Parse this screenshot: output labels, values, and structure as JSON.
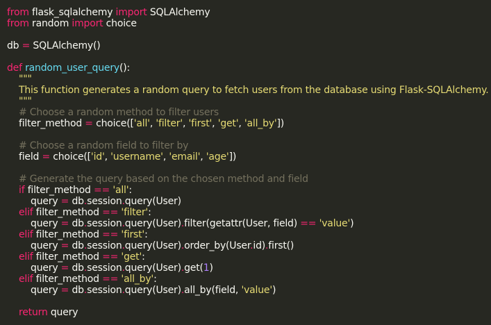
{
  "colors": {
    "background": "#272822",
    "text": "#f8f8f2",
    "keyword": "#f92672",
    "function": "#66d9ef",
    "string": "#e6db74",
    "comment": "#75715e",
    "number": "#ae81ff"
  },
  "lines": [
    [
      {
        "t": "kw",
        "v": "from"
      },
      {
        "t": "plain",
        "v": " flask_sqlalchemy "
      },
      {
        "t": "kw",
        "v": "import"
      },
      {
        "t": "plain",
        "v": " SQLAlchemy"
      }
    ],
    [
      {
        "t": "kw",
        "v": "from"
      },
      {
        "t": "plain",
        "v": " random "
      },
      {
        "t": "kw",
        "v": "import"
      },
      {
        "t": "plain",
        "v": " choice"
      }
    ],
    [],
    [
      {
        "t": "plain",
        "v": "db "
      },
      {
        "t": "op",
        "v": "="
      },
      {
        "t": "plain",
        "v": " SQLAlchemy()"
      }
    ],
    [],
    [
      {
        "t": "kw",
        "v": "def"
      },
      {
        "t": "plain",
        "v": " "
      },
      {
        "t": "fn",
        "v": "random_user_query"
      },
      {
        "t": "plain",
        "v": "():"
      }
    ],
    [
      {
        "t": "str",
        "v": "    \"\"\""
      }
    ],
    [
      {
        "t": "str",
        "v": "    This function generates a random query to fetch users from the database using Flask-SQLAlchemy."
      }
    ],
    [
      {
        "t": "str",
        "v": "    \"\"\""
      }
    ],
    [
      {
        "t": "cmt",
        "v": "    # Choose a random method to filter users"
      }
    ],
    [
      {
        "t": "plain",
        "v": "    filter_method "
      },
      {
        "t": "op",
        "v": "="
      },
      {
        "t": "plain",
        "v": " choice(["
      },
      {
        "t": "str",
        "v": "'all'"
      },
      {
        "t": "plain",
        "v": ", "
      },
      {
        "t": "str",
        "v": "'filter'"
      },
      {
        "t": "plain",
        "v": ", "
      },
      {
        "t": "str",
        "v": "'first'"
      },
      {
        "t": "plain",
        "v": ", "
      },
      {
        "t": "str",
        "v": "'get'"
      },
      {
        "t": "plain",
        "v": ", "
      },
      {
        "t": "str",
        "v": "'all_by'"
      },
      {
        "t": "plain",
        "v": "])"
      }
    ],
    [],
    [
      {
        "t": "cmt",
        "v": "    # Choose a random field to filter by"
      }
    ],
    [
      {
        "t": "plain",
        "v": "    field "
      },
      {
        "t": "op",
        "v": "="
      },
      {
        "t": "plain",
        "v": " choice(["
      },
      {
        "t": "str",
        "v": "'id'"
      },
      {
        "t": "plain",
        "v": ", "
      },
      {
        "t": "str",
        "v": "'username'"
      },
      {
        "t": "plain",
        "v": ", "
      },
      {
        "t": "str",
        "v": "'email'"
      },
      {
        "t": "plain",
        "v": ", "
      },
      {
        "t": "str",
        "v": "'age'"
      },
      {
        "t": "plain",
        "v": "])"
      }
    ],
    [],
    [
      {
        "t": "cmt",
        "v": "    # Generate the query based on the chosen method and field"
      }
    ],
    [
      {
        "t": "plain",
        "v": "    "
      },
      {
        "t": "kw",
        "v": "if"
      },
      {
        "t": "plain",
        "v": " filter_method "
      },
      {
        "t": "op",
        "v": "=="
      },
      {
        "t": "plain",
        "v": " "
      },
      {
        "t": "str",
        "v": "'all'"
      },
      {
        "t": "plain",
        "v": ":"
      }
    ],
    [
      {
        "t": "plain",
        "v": "        query "
      },
      {
        "t": "op",
        "v": "="
      },
      {
        "t": "plain",
        "v": " db"
      },
      {
        "t": "op",
        "v": "."
      },
      {
        "t": "plain",
        "v": "session"
      },
      {
        "t": "op",
        "v": "."
      },
      {
        "t": "plain",
        "v": "query(User)"
      }
    ],
    [
      {
        "t": "plain",
        "v": "    "
      },
      {
        "t": "kw",
        "v": "elif"
      },
      {
        "t": "plain",
        "v": " filter_method "
      },
      {
        "t": "op",
        "v": "=="
      },
      {
        "t": "plain",
        "v": " "
      },
      {
        "t": "str",
        "v": "'filter'"
      },
      {
        "t": "plain",
        "v": ":"
      }
    ],
    [
      {
        "t": "plain",
        "v": "        query "
      },
      {
        "t": "op",
        "v": "="
      },
      {
        "t": "plain",
        "v": " db"
      },
      {
        "t": "op",
        "v": "."
      },
      {
        "t": "plain",
        "v": "session"
      },
      {
        "t": "op",
        "v": "."
      },
      {
        "t": "plain",
        "v": "query(User)"
      },
      {
        "t": "op",
        "v": "."
      },
      {
        "t": "plain",
        "v": "filter(getattr(User, field) "
      },
      {
        "t": "op",
        "v": "=="
      },
      {
        "t": "plain",
        "v": " "
      },
      {
        "t": "str",
        "v": "'value'"
      },
      {
        "t": "plain",
        "v": ")"
      }
    ],
    [
      {
        "t": "plain",
        "v": "    "
      },
      {
        "t": "kw",
        "v": "elif"
      },
      {
        "t": "plain",
        "v": " filter_method "
      },
      {
        "t": "op",
        "v": "=="
      },
      {
        "t": "plain",
        "v": " "
      },
      {
        "t": "str",
        "v": "'first'"
      },
      {
        "t": "plain",
        "v": ":"
      }
    ],
    [
      {
        "t": "plain",
        "v": "        query "
      },
      {
        "t": "op",
        "v": "="
      },
      {
        "t": "plain",
        "v": " db"
      },
      {
        "t": "op",
        "v": "."
      },
      {
        "t": "plain",
        "v": "session"
      },
      {
        "t": "op",
        "v": "."
      },
      {
        "t": "plain",
        "v": "query(User)"
      },
      {
        "t": "op",
        "v": "."
      },
      {
        "t": "plain",
        "v": "order_by(User"
      },
      {
        "t": "op",
        "v": "."
      },
      {
        "t": "plain",
        "v": "id)"
      },
      {
        "t": "op",
        "v": "."
      },
      {
        "t": "plain",
        "v": "first()"
      }
    ],
    [
      {
        "t": "plain",
        "v": "    "
      },
      {
        "t": "kw",
        "v": "elif"
      },
      {
        "t": "plain",
        "v": " filter_method "
      },
      {
        "t": "op",
        "v": "=="
      },
      {
        "t": "plain",
        "v": " "
      },
      {
        "t": "str",
        "v": "'get'"
      },
      {
        "t": "plain",
        "v": ":"
      }
    ],
    [
      {
        "t": "plain",
        "v": "        query "
      },
      {
        "t": "op",
        "v": "="
      },
      {
        "t": "plain",
        "v": " db"
      },
      {
        "t": "op",
        "v": "."
      },
      {
        "t": "plain",
        "v": "session"
      },
      {
        "t": "op",
        "v": "."
      },
      {
        "t": "plain",
        "v": "query(User)"
      },
      {
        "t": "op",
        "v": "."
      },
      {
        "t": "plain",
        "v": "get("
      },
      {
        "t": "num",
        "v": "1"
      },
      {
        "t": "plain",
        "v": ")"
      }
    ],
    [
      {
        "t": "plain",
        "v": "    "
      },
      {
        "t": "kw",
        "v": "elif"
      },
      {
        "t": "plain",
        "v": " filter_method "
      },
      {
        "t": "op",
        "v": "=="
      },
      {
        "t": "plain",
        "v": " "
      },
      {
        "t": "str",
        "v": "'all_by'"
      },
      {
        "t": "plain",
        "v": ":"
      }
    ],
    [
      {
        "t": "plain",
        "v": "        query "
      },
      {
        "t": "op",
        "v": "="
      },
      {
        "t": "plain",
        "v": " db"
      },
      {
        "t": "op",
        "v": "."
      },
      {
        "t": "plain",
        "v": "session"
      },
      {
        "t": "op",
        "v": "."
      },
      {
        "t": "plain",
        "v": "query(User)"
      },
      {
        "t": "op",
        "v": "."
      },
      {
        "t": "plain",
        "v": "all_by(field, "
      },
      {
        "t": "str",
        "v": "'value'"
      },
      {
        "t": "plain",
        "v": ")"
      }
    ],
    [],
    [
      {
        "t": "plain",
        "v": "    "
      },
      {
        "t": "kw",
        "v": "return"
      },
      {
        "t": "plain",
        "v": " query"
      }
    ]
  ]
}
